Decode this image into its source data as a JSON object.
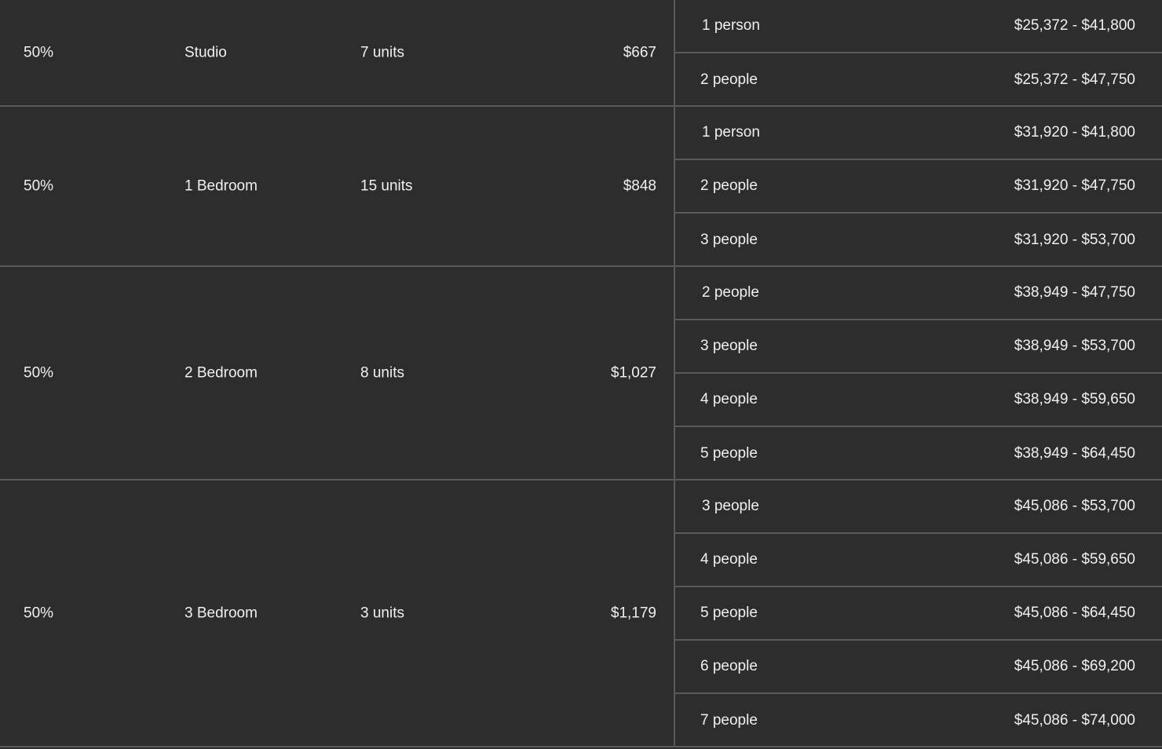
{
  "rows": [
    {
      "ami": "50%",
      "unit_type": "Studio",
      "units": "7 units",
      "rent": "$667",
      "household_incomes": [
        {
          "household": "1 person",
          "income": "$25,372 - $41,800"
        },
        {
          "household": "2 people",
          "income": "$25,372 - $47,750"
        }
      ]
    },
    {
      "ami": "50%",
      "unit_type": "1 Bedroom",
      "units": "15 units",
      "rent": "$848",
      "household_incomes": [
        {
          "household": "1 person",
          "income": "$31,920 - $41,800"
        },
        {
          "household": "2 people",
          "income": "$31,920 - $47,750"
        },
        {
          "household": "3 people",
          "income": "$31,920 - $53,700"
        }
      ]
    },
    {
      "ami": "50%",
      "unit_type": "2 Bedroom",
      "units": "8 units",
      "rent": "$1,027",
      "household_incomes": [
        {
          "household": "2 people",
          "income": "$38,949 - $47,750"
        },
        {
          "household": "3 people",
          "income": "$38,949 - $53,700"
        },
        {
          "household": "4 people",
          "income": "$38,949 - $59,650"
        },
        {
          "household": "5 people",
          "income": "$38,949 - $64,450"
        }
      ]
    },
    {
      "ami": "50%",
      "unit_type": "3 Bedroom",
      "units": "3 units",
      "rent": "$1,179",
      "household_incomes": [
        {
          "household": "3 people",
          "income": "$45,086 - $53,700"
        },
        {
          "household": "4 people",
          "income": "$45,086 - $59,650"
        },
        {
          "household": "5 people",
          "income": "$45,086 - $64,450"
        },
        {
          "household": "6 people",
          "income": "$45,086 - $69,200"
        },
        {
          "household": "7 people",
          "income": "$45,086 - $74,000"
        }
      ]
    }
  ]
}
